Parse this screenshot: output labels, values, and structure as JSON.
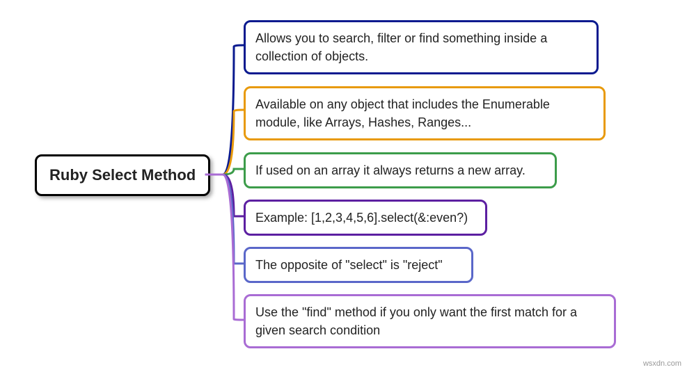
{
  "root": {
    "label": "Ruby Select Method"
  },
  "children": [
    {
      "text": "Allows you to search, filter or find something inside a collection of objects.",
      "color": "#0a1a8f"
    },
    {
      "text": "Available on any object that includes the Enumerable module, like Arrays, Hashes, Ranges...",
      "color": "#e89a0c"
    },
    {
      "text": "If used on an array it always returns a new array.",
      "color": "#3c9c4a"
    },
    {
      "text": "Example: [1,2,3,4,5,6].select(&:even?)",
      "color": "#5c1fa1"
    },
    {
      "text": "The opposite of \"select\" is \"reject\"",
      "color": "#5a67c9"
    },
    {
      "text": "Use the \"find\" method if you only want the first match for a given search condition",
      "color": "#a96cd4"
    }
  ],
  "watermark": "wsxdn.com"
}
